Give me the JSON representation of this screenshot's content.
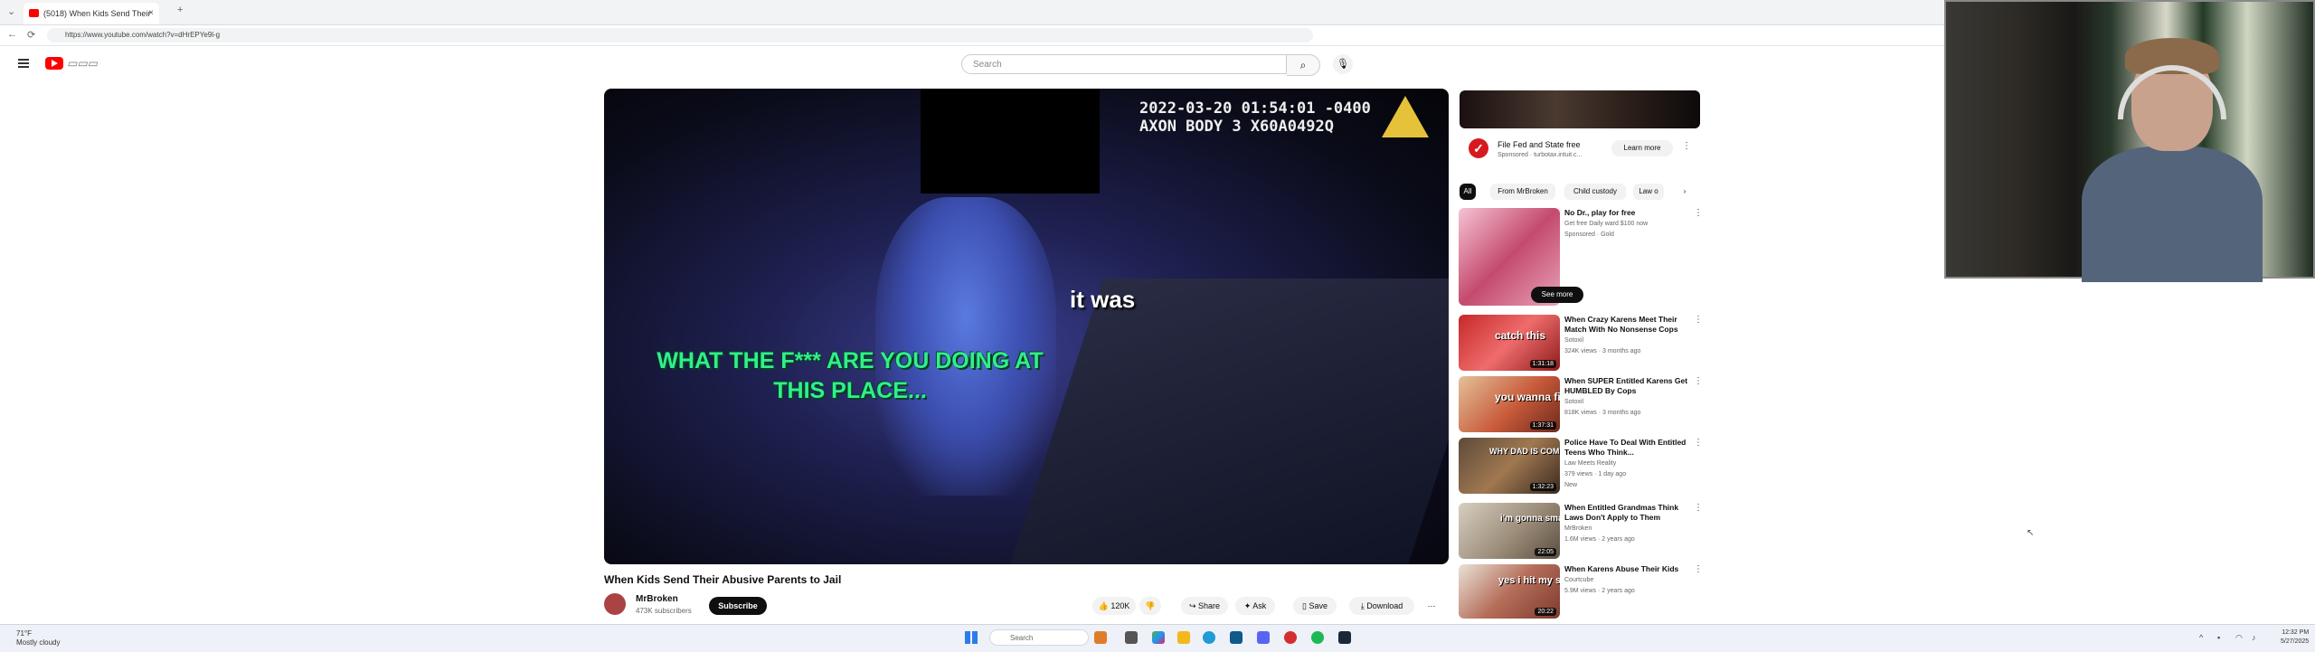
{
  "browser": {
    "tab_title": "(5018) When Kids Send Their",
    "url": "https://www.youtube.com/watch?v=dHrEPYe9l-g",
    "new_tab": "+",
    "close": "×",
    "back": "←",
    "reload": "⟳"
  },
  "youtube": {
    "search_placeholder": "Search",
    "video": {
      "timestamp": "2022-03-20 01:54:01 -0400\nAXON BODY 3 X60A0492Q",
      "subtitle_green": "WHAT THE F*** ARE YOU DOING AT THIS PLACE...",
      "subtitle_white": "it was"
    },
    "title": "When Kids Send Their Abusive Parents to Jail",
    "channel": {
      "name": "MrBroken",
      "subscribers": "473K subscribers",
      "subscribe_label": "Subscribe"
    },
    "actions": {
      "likes": "120K",
      "share": "Share",
      "ask": "Ask",
      "save": "Save",
      "download": "Download",
      "more": "⋯"
    },
    "ad": {
      "title": "File Fed and State free",
      "sponsored": "Sponsored · turbotax.intuit.c...",
      "learn_more": "Learn more"
    },
    "chips": [
      "All",
      "From MrBroken",
      "Child custody",
      "Law o"
    ],
    "recommendations": [
      {
        "title": "No Dr., play for free",
        "meta1": "Get free Daily ward $100 now",
        "meta2": "Sponsored · Gold",
        "thumb_text": "",
        "duration": "",
        "see_more": "See more"
      },
      {
        "title": "When Crazy Karens Meet Their Match With No Nonsense Cops",
        "meta1": "Sotoxil",
        "meta2": "324K views · 3 months ago",
        "thumb_text": "catch this",
        "duration": "1:31:18"
      },
      {
        "title": "When SUPER Entitled Karens Get HUMBLED By Cops",
        "meta1": "Sotoxil",
        "meta2": "818K views · 3 months ago",
        "thumb_text": "you wanna fight",
        "duration": "1:37:31"
      },
      {
        "title": "Police Have To Deal With Entitled Teens Who Think...",
        "meta1": "Law Meets Reality",
        "meta2": "379 views · 1 day ago",
        "meta3": "New",
        "thumb_text": "WHY DAD IS COMING?",
        "duration": "1:32:23"
      },
      {
        "title": "When Entitled Grandmas Think Laws Don't Apply to Them",
        "meta1": "MrBroken",
        "meta2": "1.6M views · 2 years ago",
        "thumb_text": "i'm gonna smash you",
        "duration": "22:05"
      },
      {
        "title": "When Karens Abuse Their Kids",
        "meta1": "Courtcube",
        "meta2": "5.9M views · 2 years ago",
        "thumb_text": "yes i hit my son!",
        "duration": "20:22"
      }
    ]
  },
  "taskbar": {
    "weather_temp": "71°F",
    "weather_desc": "Mostly cloudy",
    "search": "Search",
    "time": "12:32 PM",
    "date": "5/27/2025"
  },
  "colors": {
    "brand_red": "#ff0000",
    "subtitle_green": "#2ff08c",
    "axon_yellow": "#e6c23a"
  }
}
